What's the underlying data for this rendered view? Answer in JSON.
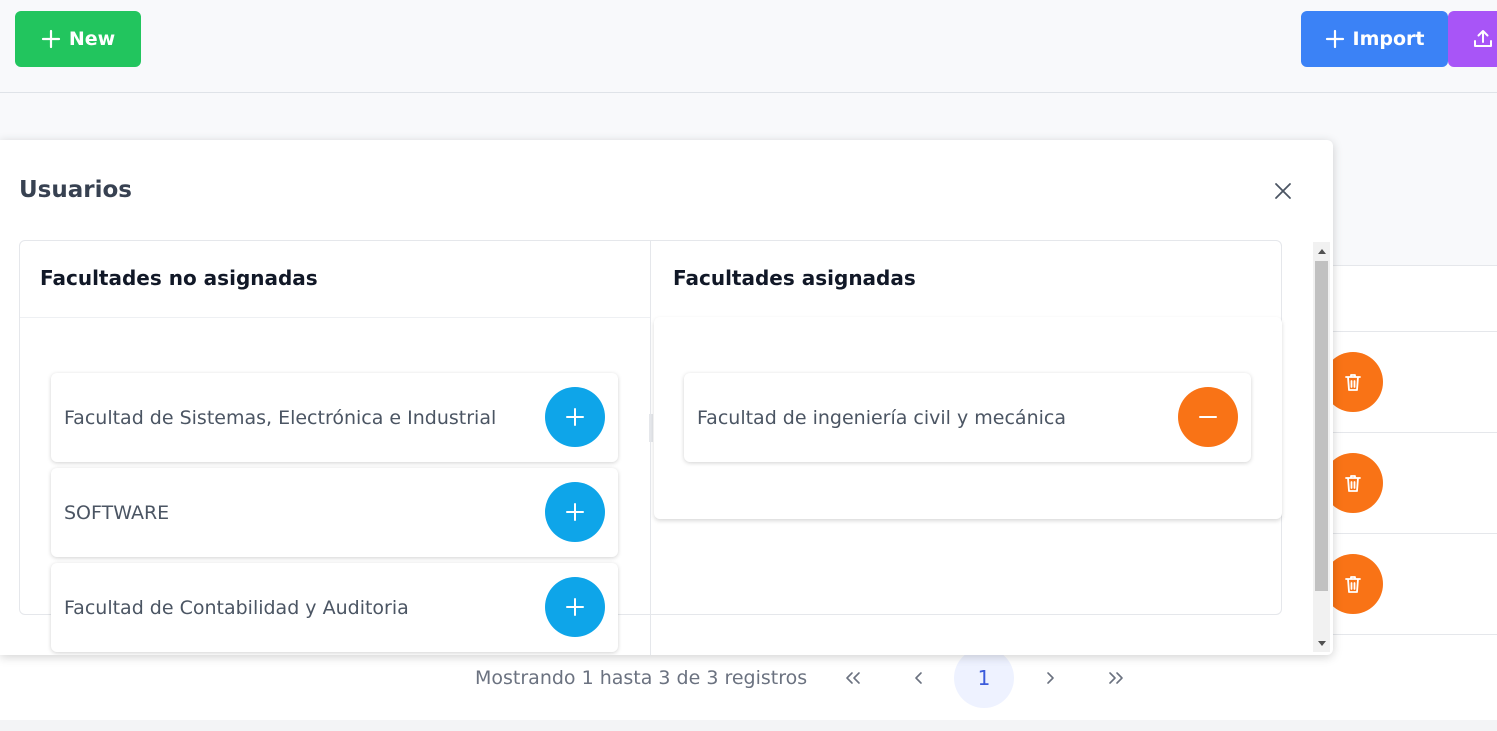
{
  "toolbar": {
    "new_label": "New",
    "import_label": "Import"
  },
  "dialog": {
    "title": "Usuarios",
    "unassigned": {
      "header": "Facultades no asignadas",
      "items": [
        "Facultad de Sistemas, Electrónica e Industrial",
        "SOFTWARE",
        "Facultad de Contabilidad y Auditoria"
      ]
    },
    "assigned": {
      "header": "Facultades asignadas",
      "items": [
        "Facultad de ingeniería civil y mecánica"
      ]
    }
  },
  "pagination": {
    "info": "Mostrando 1 hasta 3 de 3 registros",
    "first": "«",
    "prev": "‹",
    "current_page": "1",
    "next": "›",
    "last": "»"
  },
  "colors": {
    "new_button": "#22c55e",
    "import_button": "#3b82f6",
    "export_button": "#a855f7",
    "add_button": "#0ea5e9",
    "remove_button": "#f97316",
    "delete_button": "#f97316"
  },
  "icons": {
    "new": "plus-icon",
    "import": "plus-icon",
    "export": "upload-icon",
    "close": "close-icon",
    "add": "plus-icon",
    "remove": "minus-icon",
    "delete": "trash-icon"
  }
}
